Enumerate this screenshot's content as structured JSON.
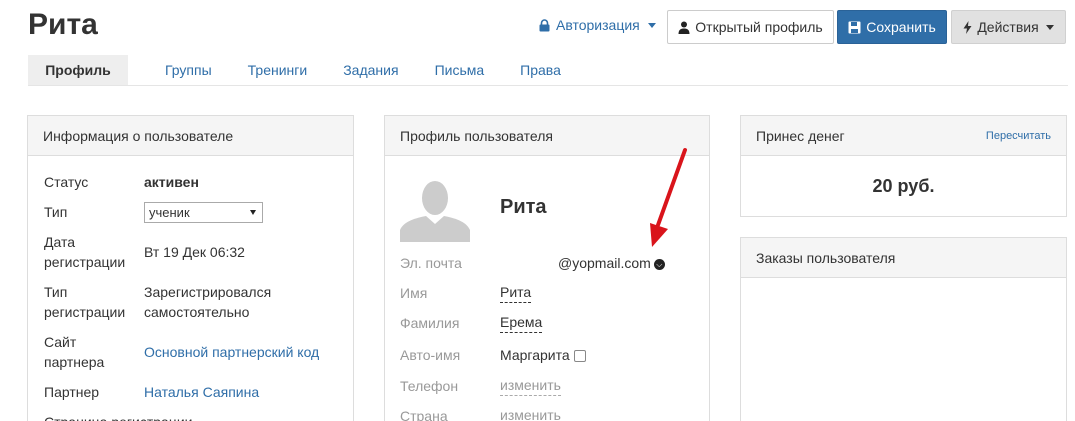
{
  "header": {
    "title": "Рита",
    "auth_label": "Авторизация",
    "open_profile_label": "Открытый профиль",
    "save_label": "Сохранить",
    "actions_label": "Действия"
  },
  "tabs": [
    {
      "label": "Профиль",
      "active": true
    },
    {
      "label": "Группы"
    },
    {
      "label": "Тренинги"
    },
    {
      "label": "Задания"
    },
    {
      "label": "Письма"
    },
    {
      "label": "Права"
    }
  ],
  "user_info": {
    "heading": "Информация о пользователе",
    "status_label": "Статус",
    "status_value": "активен",
    "type_label": "Тип",
    "type_value": "ученик",
    "reg_date_label": "Дата регистрации",
    "reg_date_value": "Вт 19 Дек 06:32",
    "reg_type_label": "Тип регистрации",
    "reg_type_value": "Зарегистрировался самостоятельно",
    "partner_site_label": "Сайт партнера",
    "partner_site_value": "Основной партнерский код",
    "partner_label": "Партнер",
    "partner_value": "Наталья Саяпина",
    "next_label": "Страница регистрации"
  },
  "profile": {
    "heading": "Профиль пользователя",
    "name": "Рита",
    "email_label": "Эл. почта",
    "email_value": "@yopmail.com",
    "first_name_label": "Имя",
    "first_name_value": "Рита",
    "last_name_label": "Фамилия",
    "last_name_value": "Ерема",
    "auto_name_label": "Авто-имя",
    "auto_name_value": "Маргарита",
    "phone_label": "Телефон",
    "phone_value": "изменить",
    "country_label": "Страна",
    "country_value": "изменить"
  },
  "money": {
    "heading": "Принес денег",
    "recalc_label": "Пересчитать",
    "value": "20 руб."
  },
  "orders": {
    "heading": "Заказы пользователя"
  },
  "icons": {
    "auth": "lock-icon",
    "profile": "user-icon",
    "save": "floppy-icon",
    "actions": "bolt-icon"
  },
  "colors": {
    "accent": "#2f6ea8",
    "annotation_arrow": "#d9141b"
  }
}
